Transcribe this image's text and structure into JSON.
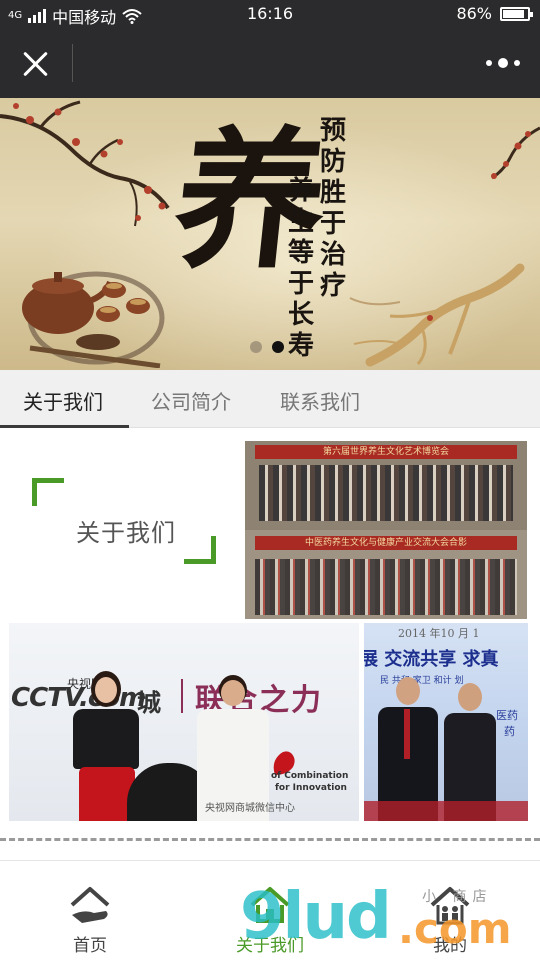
{
  "status_bar": {
    "network": "4G",
    "carrier": "中国移动",
    "time": "16:16",
    "battery_text": "86%",
    "battery_level": 0.86
  },
  "title_bar": {
    "close_icon": "close-icon",
    "more_icon": "more-dots-icon"
  },
  "banner": {
    "big_character": "养",
    "poem_right": "预防胜于治疗",
    "poem_left": "养生等于长寿",
    "slide_count": 2,
    "active_slide": 2
  },
  "tabs": [
    {
      "label": "关于我们",
      "active": true
    },
    {
      "label": "公司简介",
      "active": false
    },
    {
      "label": "联系我们",
      "active": false
    }
  ],
  "about": {
    "title": "关于我们"
  },
  "photos": {
    "photo_a": {
      "banner_top": "第六届世界养生文化艺术博览会",
      "banner_bottom": "中医药养生文化与健康产业交流大会合影"
    },
    "photo_b": {
      "brand_small": "央视网",
      "brand": "CCTV.com",
      "city_char": "城",
      "slogan": "联合之力",
      "caption_en_1": "of Combination",
      "caption_en_2": "for Innovation",
      "watermark": "央视网商城微信中心"
    },
    "photo_c": {
      "date_line": "2014 年10 月 1",
      "slogan": "展 交流共享 求真",
      "line2": "民 共和  家卫  和计 划",
      "side1": "医药",
      "side2": "药"
    }
  },
  "bottom_nav": [
    {
      "label": "首页",
      "icon": "home-hand-icon",
      "active": false
    },
    {
      "label": "关于我们",
      "icon": "house-icon",
      "active": true
    },
    {
      "label": "我的",
      "icon": "house-people-icon",
      "active": false
    }
  ],
  "watermark": {
    "text_main": "9lud",
    "text_com": ".com",
    "text_shop": "小 商店"
  },
  "colors": {
    "accent": "#4a9a27",
    "titlebar": "#2b2b2d",
    "tab_bg": "#f0f0f0"
  }
}
